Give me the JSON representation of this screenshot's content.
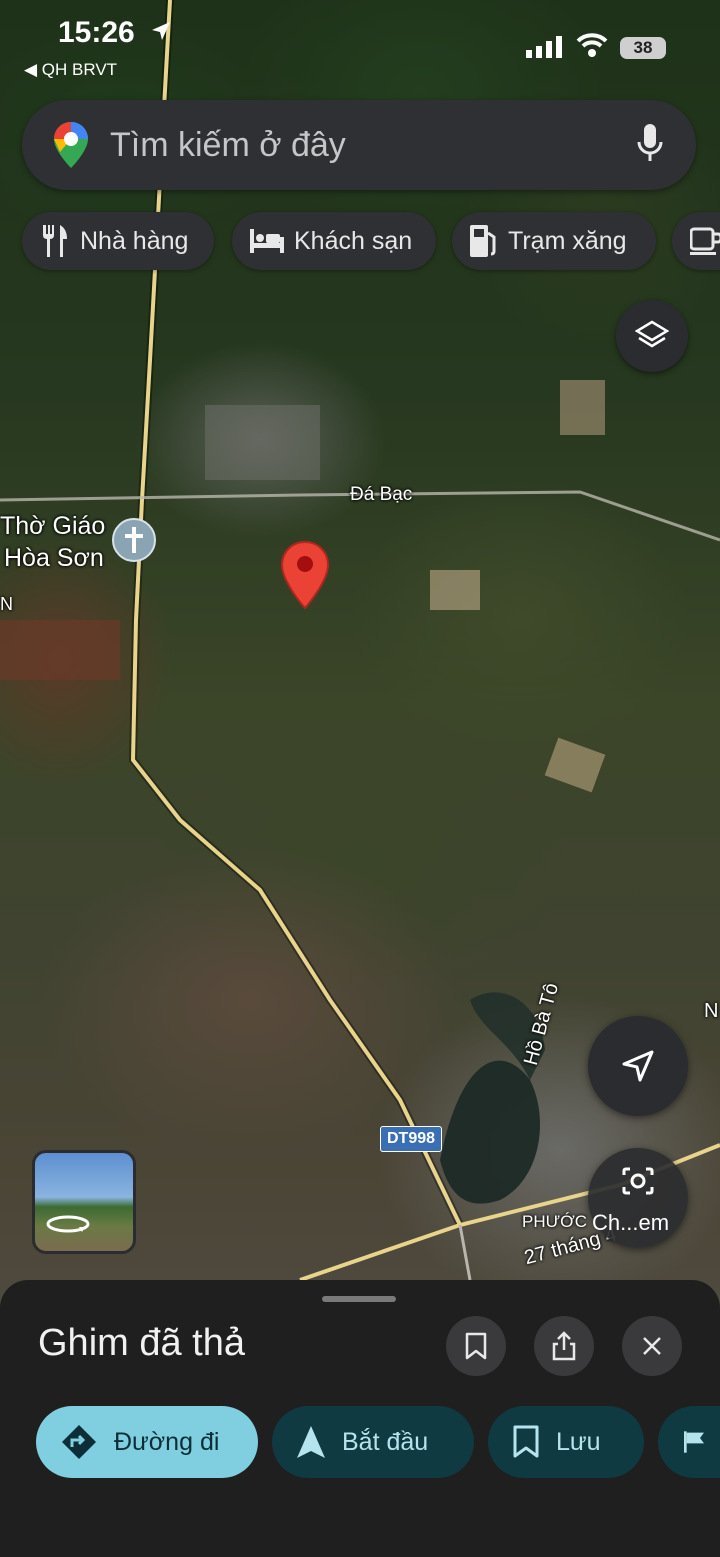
{
  "status_bar": {
    "time": "15:26",
    "carrier": "◀ QH BRVT",
    "battery": "38"
  },
  "search": {
    "placeholder": "Tìm kiếm ở đây"
  },
  "chips": [
    {
      "label": "Nhà hàng",
      "icon": "fork-knife-icon"
    },
    {
      "label": "Khách sạn",
      "icon": "bed-icon"
    },
    {
      "label": "Trạm xăng",
      "icon": "gas-station-icon"
    },
    {
      "label": "",
      "icon": "coffee-icon"
    }
  ],
  "map_labels": {
    "road_da_bac": "Đá Bạc",
    "place_tho_giao": "Thờ Giáo",
    "place_hoa_son": "Hòa Sơn",
    "edge_n_left": "N",
    "edge_n_right": "N",
    "lake": "Hồ Bà Tô",
    "route": "DT998",
    "phuoc": "PHƯỚC",
    "street_27_thang_4": "27 tháng 4"
  },
  "lens_button": {
    "label": "Ch...em"
  },
  "sheet": {
    "title": "Ghim đã thả",
    "actions": [
      {
        "label": "Đường đi",
        "style": "primary"
      },
      {
        "label": "Bắt đầu",
        "style": "secondary"
      },
      {
        "label": "Lưu",
        "style": "secondary"
      }
    ]
  },
  "colors": {
    "pin_red": "#ea4335",
    "primary_action": "#7fcfe0",
    "secondary_action": "#0f3a42",
    "road_yellow": "#e8d48a"
  }
}
